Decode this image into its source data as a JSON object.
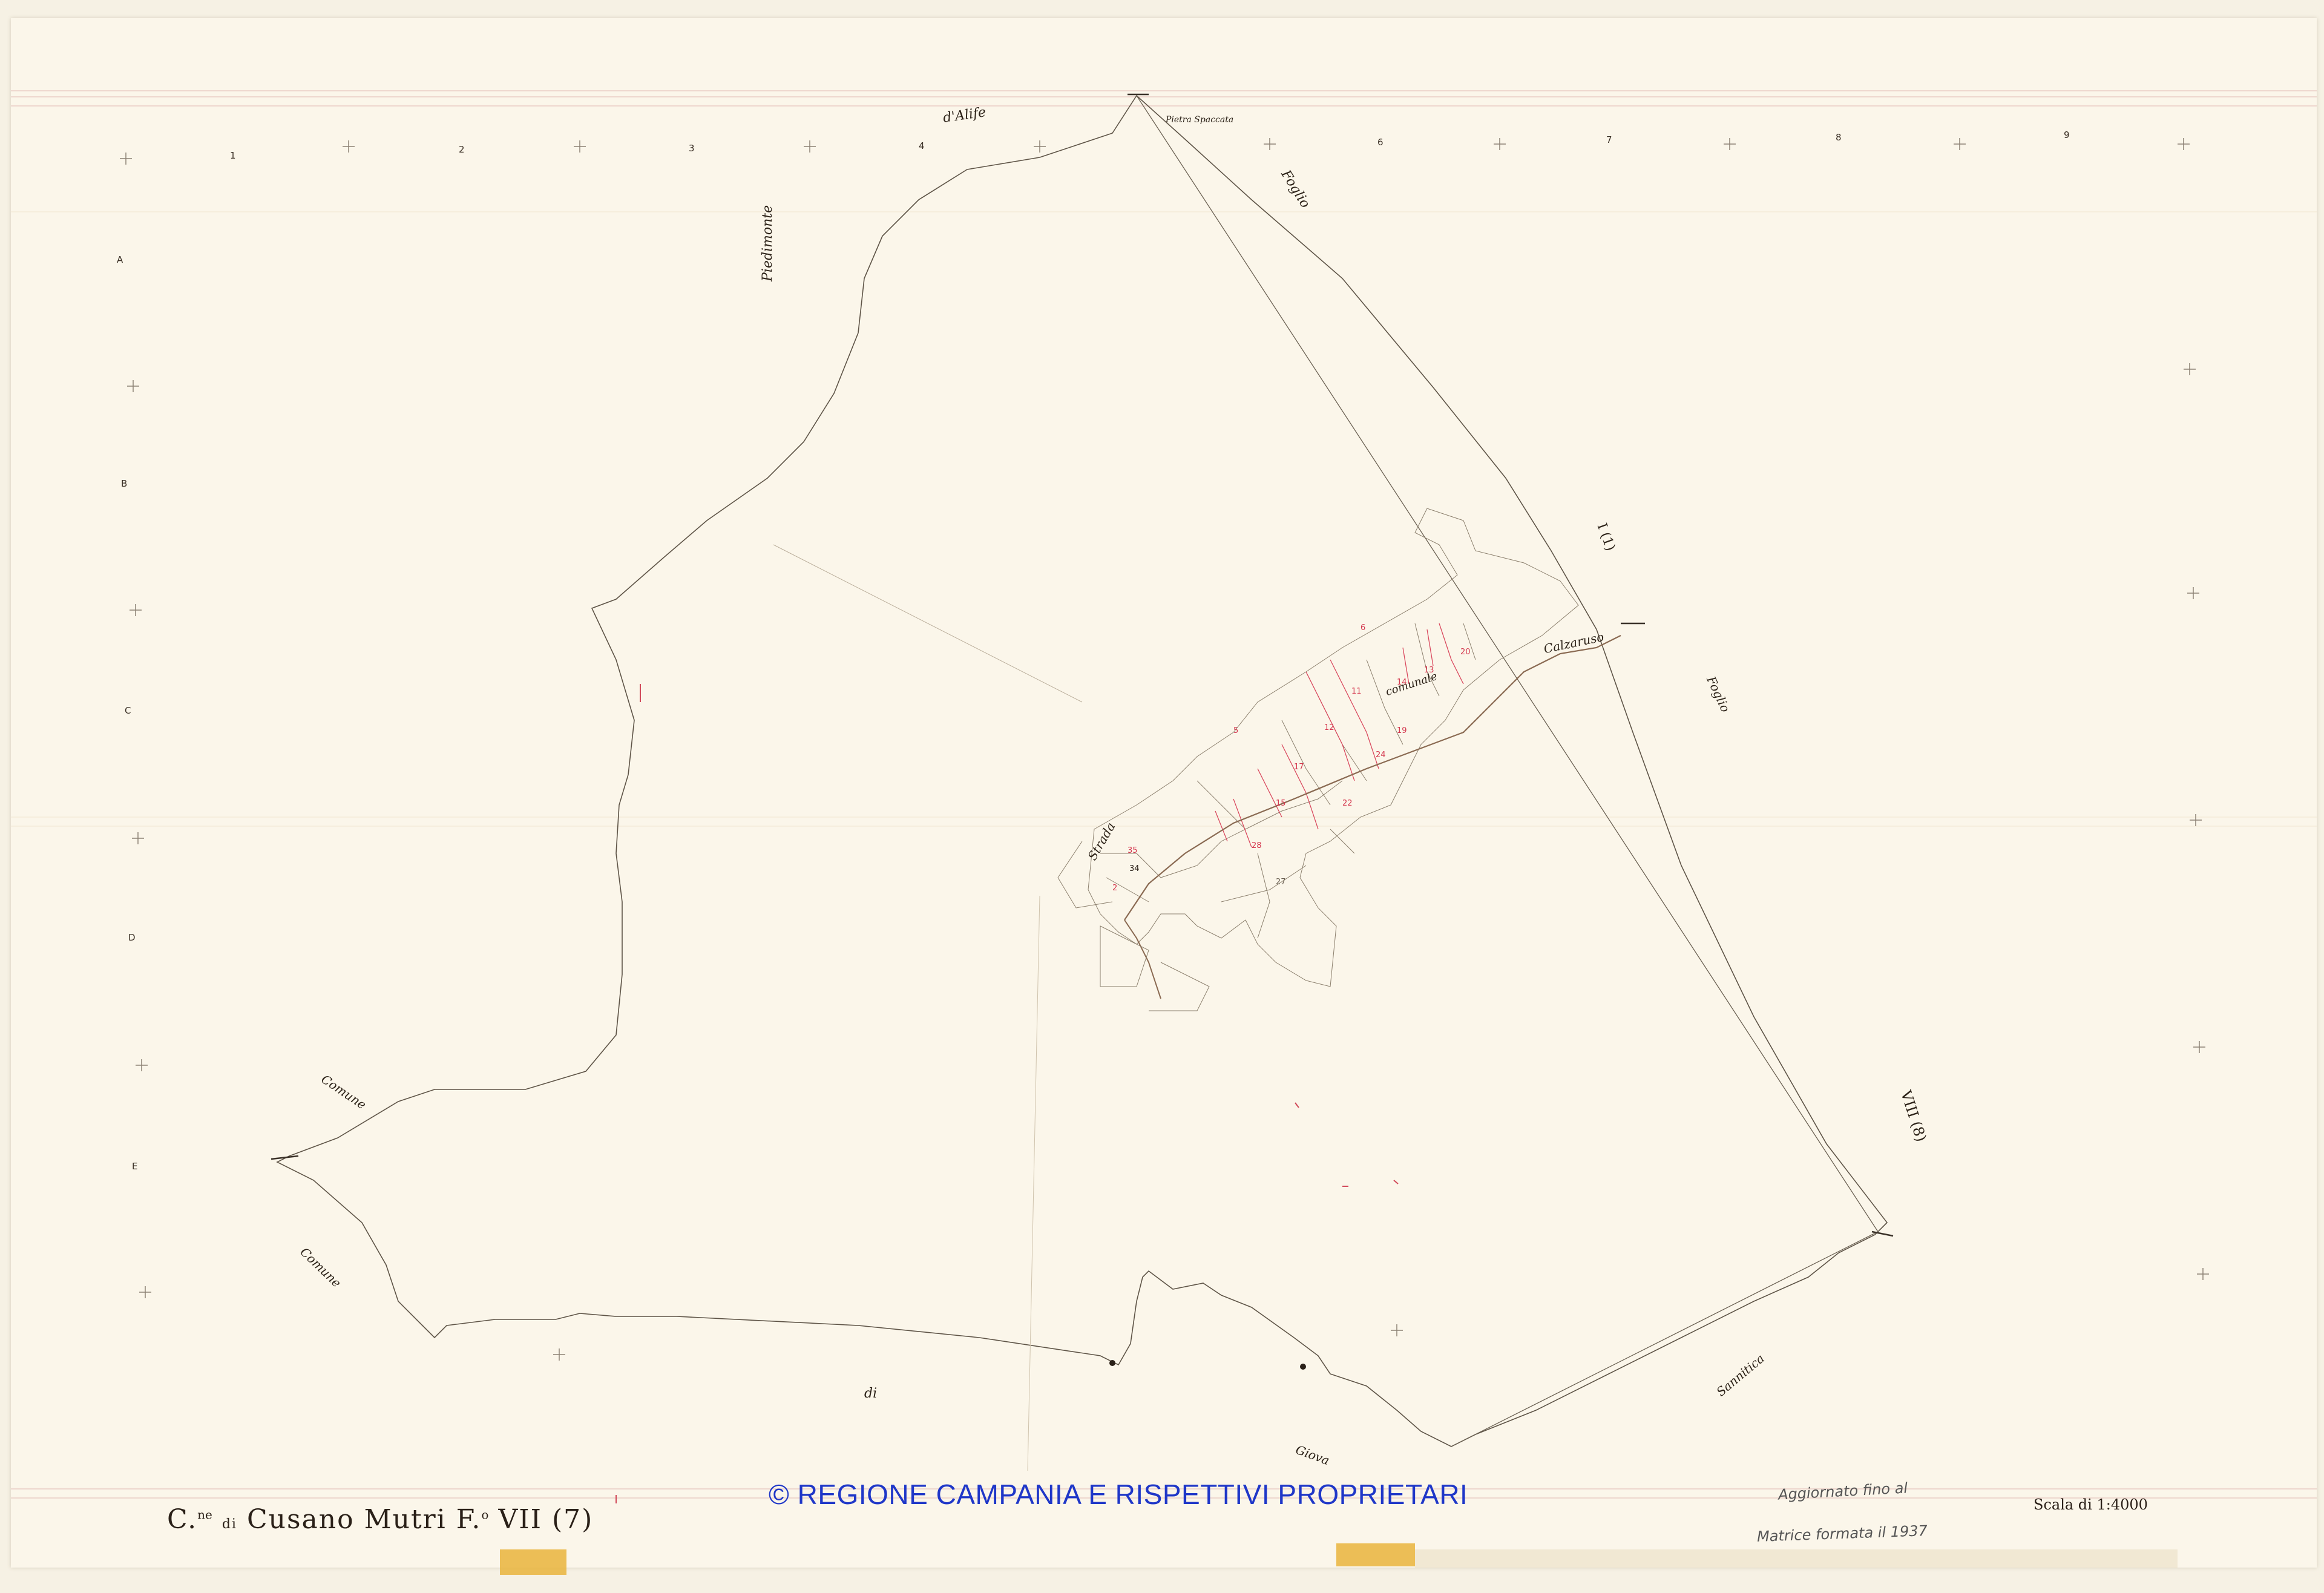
{
  "sheet": {
    "title_prefix": "C.",
    "title_sup": "ne",
    "title_di": "di",
    "title_main": "Cusano Mutri F.",
    "title_sup2": "o",
    "title_sheet": "VII (7)",
    "scale": "Scala di 1:4000",
    "updated": "Aggiornato fino al",
    "matrix": "Matrice formata il 1937",
    "copyright": "© REGIONE CAMPANIA E RISPETTIVI PROPRIETARI"
  },
  "grid": {
    "columns": [
      "1",
      "2",
      "3",
      "4",
      "6",
      "7",
      "8",
      "9"
    ],
    "rows": [
      "A",
      "B",
      "C",
      "D",
      "E"
    ]
  },
  "place_labels": {
    "dalife": "d'Alife",
    "piedimonte": "Piedimonte",
    "foglio_top": "Foglio",
    "foglio_right": "Foglio",
    "roman_1": "I (1)",
    "roman_8": "VIII (8)",
    "comune_1": "Comune",
    "comune_2": "Comune",
    "di": "di",
    "giova": "Giova",
    "sannitica": "Sannitica",
    "strada": "Strada",
    "conv": "comunale",
    "calzaruso": "Calzaruso",
    "pietra": "Pietra Spaccata"
  },
  "parcels": [
    "35",
    "34",
    "2",
    "12",
    "13",
    "20",
    "24",
    "22",
    "17",
    "15",
    "19",
    "28",
    "27",
    "11",
    "14",
    "6",
    "5"
  ]
}
